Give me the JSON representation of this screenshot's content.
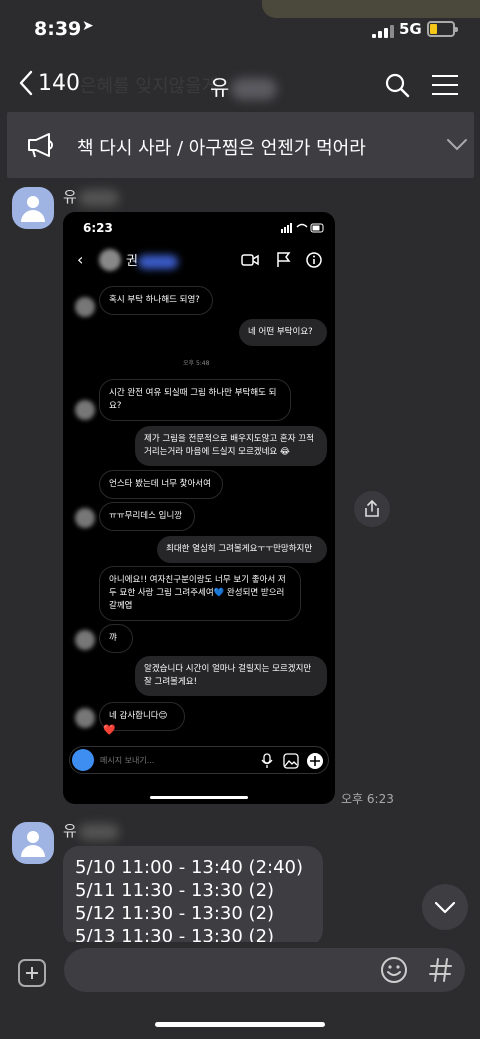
{
  "status_bar": {
    "time": "8:39",
    "location_glyph": "➤",
    "network": "5G",
    "battery_level": 0.3
  },
  "background_text": "은혜를 잊지않을게",
  "header": {
    "back_count": "140",
    "title": "유"
  },
  "notice": {
    "text": "책 다시 사라 / 아구찜은 언젠가 먹어라"
  },
  "messages": {
    "sender_first": "유",
    "sender_second": "유",
    "image_time": "오후 6:23",
    "schedule_lines": [
      "5/10 11:00 - 13:40 (2:40)",
      "5/11 11:30 - 13:30 (2)",
      "5/12 11:30 - 13:30 (2)",
      "5/13 11:30 - 13:30 (2)"
    ]
  },
  "screenshot": {
    "time": "6:23",
    "contact_name": "권",
    "stamp": "오후 5:48",
    "bubbles": [
      {
        "side": "in",
        "text": "혹시 부탁 하나해드 되영?"
      },
      {
        "side": "out",
        "text": "네 어떤 부탁이요?"
      },
      {
        "side": "in",
        "text": "시간 완전 여유 되실때 그림 하나만 부탁해도 되요?"
      },
      {
        "side": "out",
        "text": "제가 그림을 전문적으로 배우지도않고 혼자 끄적거리는거라 마음에 드실지 모르겠네요 😂"
      },
      {
        "side": "in",
        "text": "언스타 봤는데 너무 찿아서여"
      },
      {
        "side": "in",
        "text": "ㅠㅠ무리데스 입니깡"
      },
      {
        "side": "out",
        "text": "최대한 열심히 그려볼게요ㅜㅜ만망하지만"
      },
      {
        "side": "in",
        "text": "아니에요!! 여자친구분이랑도 너무 보기 좋아서 저두 묘한 사랑 그림 그려주세여💙 완성되면 받으러 갈께엽"
      },
      {
        "side": "in",
        "text": "꺄"
      },
      {
        "side": "out",
        "text": "알겠습니다 시간이 얼마나 걸릴지는 모르겠지만 잘 그려볼게요!"
      },
      {
        "side": "in",
        "text": "네 감사합니다😊"
      }
    ],
    "reaction": "❤️",
    "compose_placeholder": "메시지 보내기..."
  },
  "input": {
    "placeholder": ""
  },
  "colors": {
    "background": "#2c2c2e",
    "bubble": "#3d3d42",
    "avatar": "#9fb4e3",
    "battery": "#f5c518"
  }
}
